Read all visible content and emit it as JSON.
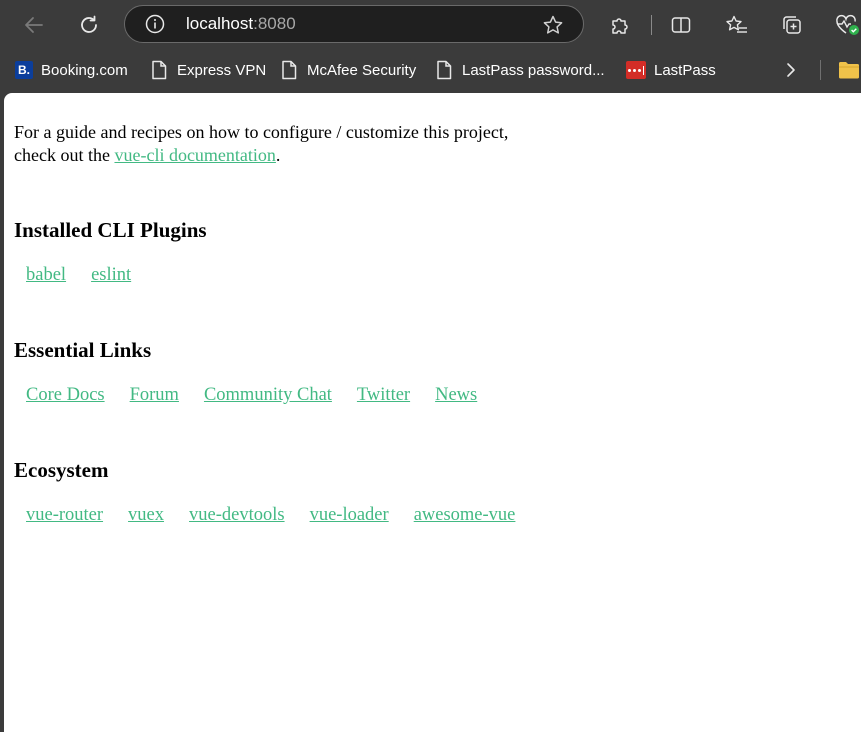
{
  "browser": {
    "url_host": "localhost",
    "url_port": ":8080",
    "bookmarks": [
      {
        "label": "Booking.com",
        "icon": "booking-icon"
      },
      {
        "label": "Express VPN",
        "icon": "page-icon"
      },
      {
        "label": "McAfee Security",
        "icon": "page-icon"
      },
      {
        "label": "LastPass password...",
        "icon": "page-icon"
      },
      {
        "label": "LastPass",
        "icon": "lastpass-icon"
      }
    ]
  },
  "page": {
    "intro_text": "For a guide and recipes on how to configure / customize this project,",
    "intro_prefix": "check out the ",
    "intro_link": "vue-cli documentation",
    "intro_suffix": ".",
    "sections": [
      {
        "title": "Installed CLI Plugins",
        "links": [
          "babel",
          "eslint"
        ]
      },
      {
        "title": "Essential Links",
        "links": [
          "Core Docs",
          "Forum",
          "Community Chat",
          "Twitter",
          "News"
        ]
      },
      {
        "title": "Ecosystem",
        "links": [
          "vue-router",
          "vuex",
          "vue-devtools",
          "vue-loader",
          "awesome-vue"
        ]
      }
    ]
  },
  "colors": {
    "link": "#42b983",
    "chrome_bg": "#3b3b3b",
    "omnibox_bg": "#1f1f1f"
  }
}
